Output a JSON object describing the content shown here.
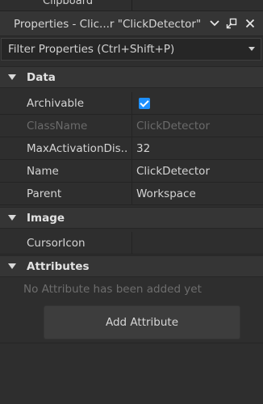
{
  "top_clip": {
    "label": "Clipboard"
  },
  "titlebar": {
    "title": "Properties - Clic...r \"ClickDetector\"",
    "icons": [
      "chevron-down-icon",
      "undock-icon",
      "close-icon"
    ]
  },
  "filter": {
    "placeholder": "Filter Properties (Ctrl+Shift+P)"
  },
  "sections": {
    "data": {
      "title": "Data",
      "rows": [
        {
          "name": "Archivable",
          "type": "checkbox",
          "checked": true
        },
        {
          "name": "ClassName",
          "value": "ClickDetector",
          "disabled": true
        },
        {
          "name": "MaxActivationDis...",
          "value": "32"
        },
        {
          "name": "Name",
          "value": "ClickDetector"
        },
        {
          "name": "Parent",
          "value": "Workspace"
        }
      ]
    },
    "image": {
      "title": "Image",
      "rows": [
        {
          "name": "CursorIcon",
          "value": ""
        }
      ]
    },
    "attributes": {
      "title": "Attributes",
      "empty_message": "No Attribute has been added yet",
      "add_button": "Add Attribute"
    }
  },
  "colors": {
    "checkbox": "#1e90ff",
    "panel_bg": "#2e2e2e",
    "header_bg": "#353535"
  }
}
